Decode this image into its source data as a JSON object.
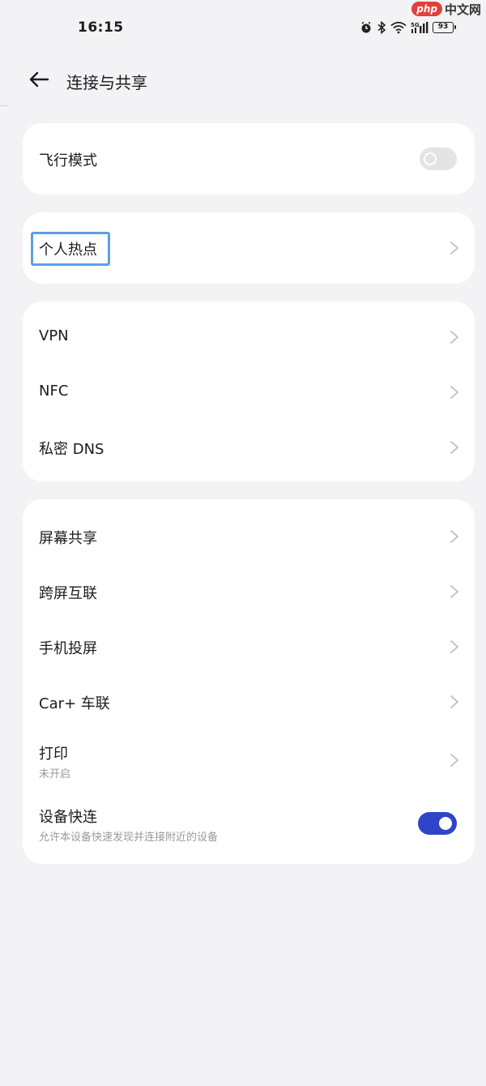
{
  "status_bar": {
    "time": "16:15",
    "battery": "93",
    "icons": [
      "alarm-icon",
      "bluetooth-icon",
      "wifi-icon",
      "cellular-5g-icon",
      "battery-icon"
    ]
  },
  "watermark": {
    "php": "php",
    "site": "中文网"
  },
  "header": {
    "title": "连接与共享",
    "back_icon": "arrow-left-icon"
  },
  "airplane": {
    "label": "飞行模式",
    "enabled": false
  },
  "hotspot": {
    "label": "个人热点"
  },
  "network_group": {
    "items": [
      {
        "label": "VPN"
      },
      {
        "label": "NFC"
      },
      {
        "label": "私密 DNS"
      }
    ]
  },
  "sharing_group": {
    "items": [
      {
        "label": "屏幕共享"
      },
      {
        "label": "跨屏互联"
      },
      {
        "label": "手机投屏"
      },
      {
        "label": "Car+ 车联"
      },
      {
        "label": "打印",
        "sub": "未开启"
      }
    ],
    "quick_connect": {
      "label": "设备快连",
      "sub": "允许本设备快速发现并连接附近的设备",
      "enabled": true
    }
  },
  "colors": {
    "background": "#f3f3f5",
    "card": "#ffffff",
    "accent": "#2f45c8",
    "highlight": "#5c9ee8"
  }
}
